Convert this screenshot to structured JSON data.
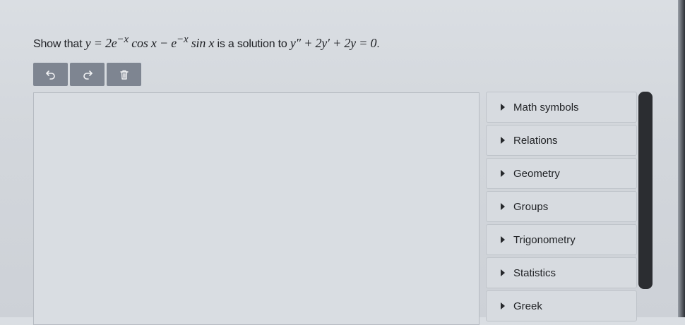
{
  "question": {
    "prefix": "Show that ",
    "equation": "y = 2e",
    "exp1": "−x",
    "mid1": " cos x − e",
    "exp2": "−x",
    "mid2": " sin x",
    "middle_text": " is a solution to ",
    "ode": "y″ + 2y′ + 2y = 0",
    "suffix": "."
  },
  "toolbar": {
    "undo_icon": "undo-icon",
    "redo_icon": "redo-icon",
    "delete_icon": "trash-icon"
  },
  "palette": {
    "items": [
      {
        "label": "Math symbols"
      },
      {
        "label": "Relations"
      },
      {
        "label": "Geometry"
      },
      {
        "label": "Groups"
      },
      {
        "label": "Trigonometry"
      },
      {
        "label": "Statistics"
      },
      {
        "label": "Greek"
      }
    ]
  },
  "colors": {
    "button_bg": "#7e8591",
    "scrollbar": "#2b2d31"
  }
}
